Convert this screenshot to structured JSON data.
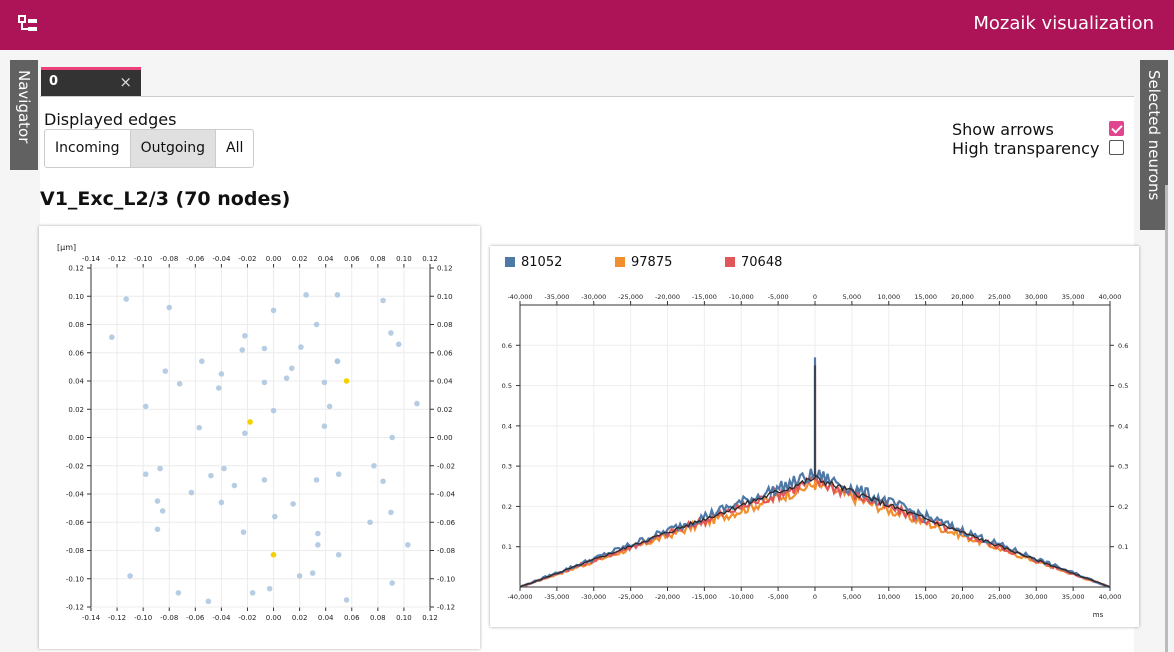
{
  "app": {
    "title": "Mozaik visualization",
    "icon": "sitemap-icon"
  },
  "side_tabs": {
    "left": "Navigator",
    "right": "Selected neurons"
  },
  "tabs": [
    {
      "label": "0",
      "close": "×"
    }
  ],
  "edges": {
    "title": "Displayed edges",
    "options": [
      "Incoming",
      "Outgoing",
      "All"
    ],
    "selected": "Outgoing"
  },
  "options": [
    {
      "label": "Show arrows",
      "checked": true
    },
    {
      "label": "High transparency",
      "checked": false
    }
  ],
  "heading": "V1_Exc_L2/3 (70 nodes)",
  "colors": {
    "accent": "#ad1457",
    "checkbox": "#e0458f",
    "node": "#a9c4df",
    "selected_node": "#f5d000"
  },
  "chart_data": [
    {
      "type": "scatter",
      "unit_label": "[μm]",
      "xlim": [
        -0.14,
        0.12
      ],
      "ylim": [
        -0.12,
        0.12
      ],
      "x_ticks": [
        "-0.14",
        "-0.12",
        "-0.10",
        "-0.08",
        "-0.06",
        "-0.04",
        "-0.02",
        "0.00",
        "0.02",
        "0.04",
        "0.06",
        "0.08",
        "0.10",
        "0.12"
      ],
      "y_ticks": [
        "0.12",
        "0.10",
        "0.08",
        "0.06",
        "0.04",
        "0.02",
        "0.00",
        "-0.02",
        "-0.04",
        "-0.06",
        "-0.08",
        "-0.10",
        "-0.12"
      ],
      "grid": true,
      "series": [
        {
          "points": [
            [
              -0.113,
              0.098
            ],
            [
              -0.124,
              0.071
            ],
            [
              -0.08,
              0.092
            ],
            [
              0.0,
              0.09
            ],
            [
              0.025,
              0.101
            ],
            [
              0.049,
              0.101
            ],
            [
              0.084,
              0.097
            ],
            [
              0.033,
              0.08
            ],
            [
              0.09,
              0.074
            ],
            [
              -0.022,
              0.072
            ],
            [
              0.096,
              0.066
            ],
            [
              -0.055,
              0.054
            ],
            [
              -0.024,
              0.062
            ],
            [
              -0.007,
              0.063
            ],
            [
              0.021,
              0.064
            ],
            [
              0.049,
              0.054
            ],
            [
              0.014,
              0.049
            ],
            [
              -0.083,
              0.047
            ],
            [
              -0.04,
              0.045
            ],
            [
              0.01,
              0.042
            ],
            [
              -0.072,
              0.038
            ],
            [
              -0.042,
              0.035
            ],
            [
              -0.007,
              0.039
            ],
            [
              0.039,
              0.039
            ],
            [
              -0.098,
              0.022
            ],
            [
              0.0,
              0.019
            ],
            [
              0.043,
              0.022
            ],
            [
              0.11,
              0.024
            ],
            [
              -0.057,
              0.007
            ],
            [
              0.039,
              0.008
            ],
            [
              -0.022,
              0.003
            ],
            [
              0.091,
              0.0
            ],
            [
              -0.098,
              -0.026
            ],
            [
              -0.087,
              -0.022
            ],
            [
              -0.038,
              -0.022
            ],
            [
              -0.048,
              -0.027
            ],
            [
              0.05,
              -0.026
            ],
            [
              0.077,
              -0.02
            ],
            [
              -0.063,
              -0.039
            ],
            [
              -0.03,
              -0.034
            ],
            [
              -0.007,
              -0.03
            ],
            [
              0.033,
              -0.03
            ],
            [
              0.084,
              -0.031
            ],
            [
              -0.089,
              -0.045
            ],
            [
              -0.04,
              -0.046
            ],
            [
              0.015,
              -0.047
            ],
            [
              -0.085,
              -0.052
            ],
            [
              0.001,
              -0.056
            ],
            [
              0.074,
              -0.06
            ],
            [
              0.09,
              -0.053
            ],
            [
              -0.089,
              -0.065
            ],
            [
              -0.023,
              -0.067
            ],
            [
              0.034,
              -0.068
            ],
            [
              0.034,
              -0.076
            ],
            [
              0.05,
              -0.083
            ],
            [
              0.103,
              -0.076
            ],
            [
              -0.11,
              -0.098
            ],
            [
              0.02,
              -0.098
            ],
            [
              0.03,
              -0.096
            ],
            [
              0.091,
              -0.103
            ],
            [
              -0.073,
              -0.11
            ],
            [
              -0.05,
              -0.116
            ],
            [
              -0.016,
              -0.11
            ],
            [
              -0.003,
              -0.107
            ],
            [
              0.056,
              -0.115
            ],
            [
              0.049,
              0.054
            ]
          ]
        },
        {
          "name": "",
          "points": [
            [
              0.056,
              0.04
            ],
            [
              -0.018,
              0.011
            ],
            [
              0.0,
              -0.083
            ]
          ]
        }
      ]
    },
    {
      "type": "line",
      "xlabel": "ms",
      "xlim": [
        -40000,
        40000
      ],
      "ylim": [
        0,
        0.7
      ],
      "x_ticks": [
        "-40,000",
        "-35,000",
        "-30,000",
        "-25,000",
        "-20,000",
        "-15,000",
        "-10,000",
        "-5,000",
        "0",
        "5,000",
        "10,000",
        "15,000",
        "20,000",
        "25,000",
        "30,000",
        "35,000",
        "40,000"
      ],
      "y_ticks": [
        "0.6",
        "0.5",
        "0.4",
        "0.3",
        "0.2",
        "0.1"
      ],
      "grid": true,
      "legend": "top-left",
      "series": [
        {
          "name": "81052",
          "color": "#4e79a7",
          "x": [
            -40000,
            -1,
            0,
            1,
            40000
          ],
          "values": [
            0.0,
            0.28,
            0.57,
            0.28,
            0.0
          ]
        },
        {
          "name": "97875",
          "color": "#f28e2b",
          "x": [
            -40000,
            -1,
            0,
            1,
            40000
          ],
          "values": [
            0.0,
            0.255,
            0.52,
            0.255,
            0.0
          ]
        },
        {
          "name": "70648",
          "color": "#e15759",
          "x": [
            -40000,
            -1,
            0,
            1,
            40000
          ],
          "values": [
            0.0,
            0.265,
            0.55,
            0.265,
            0.0
          ]
        }
      ]
    }
  ]
}
